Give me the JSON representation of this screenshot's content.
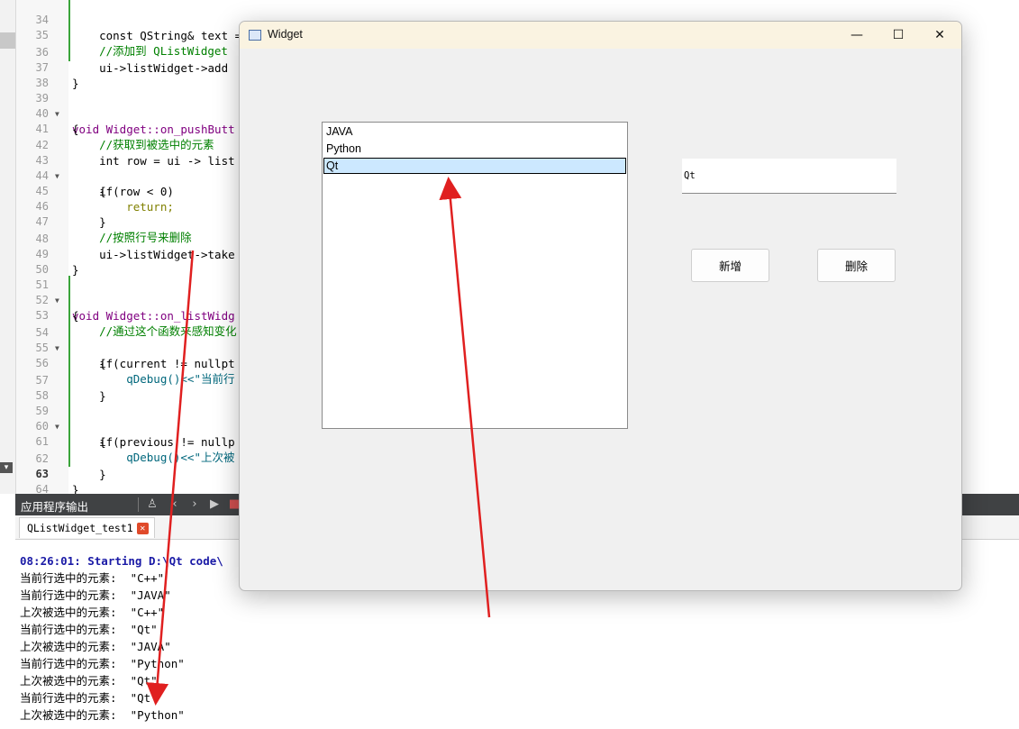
{
  "editor": {
    "lines": [
      {
        "num": "34",
        "text": "    const QString& text = ui->lineEdit->text();"
      },
      {
        "num": "35",
        "text": "    //添加到 QListWidget"
      },
      {
        "num": "36",
        "text": "    ui->listWidget->add"
      },
      {
        "num": "37",
        "text": "}"
      },
      {
        "num": "38",
        "text": ""
      },
      {
        "num": "39",
        "text": "void Widget::on_pushButt"
      },
      {
        "num": "40",
        "text": "{"
      },
      {
        "num": "41",
        "text": "    //获取到被选中的元素"
      },
      {
        "num": "42",
        "text": "    int row = ui -> list"
      },
      {
        "num": "43",
        "text": "    if(row < 0)"
      },
      {
        "num": "44",
        "text": "    {"
      },
      {
        "num": "45",
        "text": "        return;"
      },
      {
        "num": "46",
        "text": "    }"
      },
      {
        "num": "47",
        "text": "    //按照行号来删除"
      },
      {
        "num": "48",
        "text": "    ui->listWidget->take"
      },
      {
        "num": "49",
        "text": "}"
      },
      {
        "num": "50",
        "text": ""
      },
      {
        "num": "51",
        "text": "void Widget::on_listWidg"
      },
      {
        "num": "52",
        "text": "{"
      },
      {
        "num": "53",
        "text": "    //通过这个函数来感知变化"
      },
      {
        "num": "54",
        "text": "    if(current != nullpt"
      },
      {
        "num": "55",
        "text": "    {"
      },
      {
        "num": "56",
        "text": "        qDebug()<<\"当前行"
      },
      {
        "num": "57",
        "text": "    }"
      },
      {
        "num": "58",
        "text": ""
      },
      {
        "num": "59",
        "text": "    if(previous != nullp"
      },
      {
        "num": "60",
        "text": "    {"
      },
      {
        "num": "61",
        "text": "        qDebug()<<\"上次被"
      },
      {
        "num": "62",
        "text": "    }"
      },
      {
        "num": "63",
        "text": "}"
      },
      {
        "num": "64",
        "text": ""
      }
    ]
  },
  "output_pane": {
    "title": "应用程序输出",
    "tab_label": "QListWidget_test1",
    "tab_close": "✕",
    "lines": [
      "08:26:01: Starting D:\\Qt code\\",
      "当前行选中的元素:  \"C++\"",
      "当前行选中的元素:  \"JAVA\"",
      "上次被选中的元素:  \"C++\"",
      "当前行选中的元素:  \"Qt\"",
      "上次被选中的元素:  \"JAVA\"",
      "当前行选中的元素:  \"Python\"",
      "上次被选中的元素:  \"Qt\"",
      "当前行选中的元素:  \"Qt\"",
      "上次被选中的元素:  \"Python\""
    ]
  },
  "widget_window": {
    "title": "Widget",
    "controls": {
      "minimize": "—",
      "maximize": "☐",
      "close": "✕"
    },
    "list_items": [
      "JAVA",
      "Python",
      "Qt"
    ],
    "selected_item": "Qt",
    "line_edit_value": "Qt",
    "add_button": "新增",
    "delete_button": "删除"
  },
  "colors": {
    "annotation_arrow": "#e02020",
    "selection_bg": "#cce8ff",
    "titlebar_bg": "#faf3e1",
    "output_header_bg": "#404244"
  }
}
